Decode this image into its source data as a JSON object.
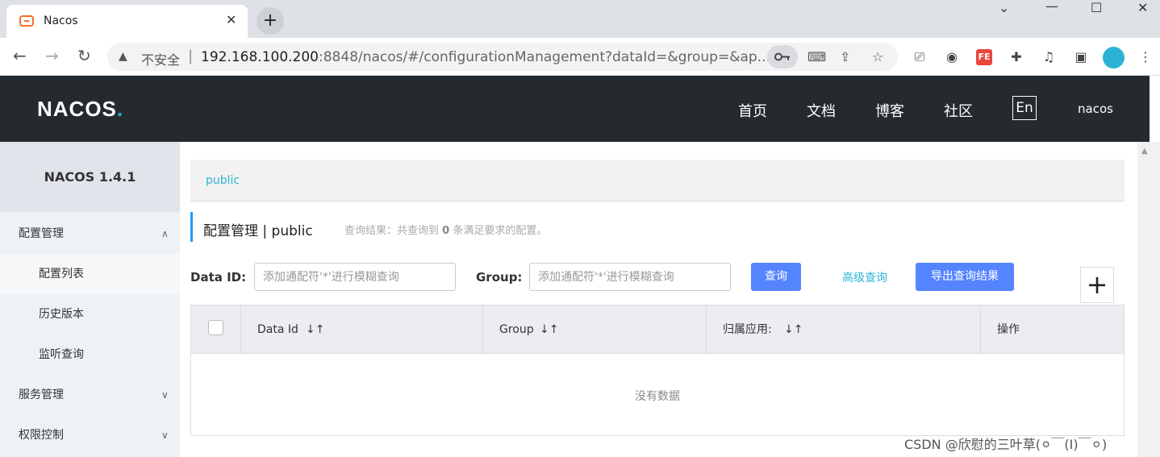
{
  "browser": {
    "tab_title": "Nacos",
    "tab_close": "✕",
    "new_tab": "+",
    "insecure_label": "不安全",
    "url_host": "192.168.100.200",
    "url_rest": ":8848/nacos/#/configurationManagement?dataId=&group=&ap...",
    "win_min": "⌄",
    "win_dash": "—",
    "win_max": "☐",
    "win_close": "✕",
    "fe_label": "FE"
  },
  "header": {
    "logo_main": "NACOS",
    "logo_dot": ".",
    "nav": [
      "首页",
      "文档",
      "博客",
      "社区"
    ],
    "lang": "En",
    "user": "nacos"
  },
  "sidebar": {
    "version": "NACOS 1.4.1",
    "groups": [
      {
        "label": "配置管理",
        "chev": "∧"
      },
      {
        "label": "服务管理",
        "chev": "∨"
      },
      {
        "label": "权限控制",
        "chev": "∨"
      }
    ],
    "sub_items": [
      "配置列表",
      "历史版本",
      "监听查询"
    ]
  },
  "main": {
    "breadcrumb": "public",
    "title": "配置管理 | public",
    "query_result_prefix": "查询结果：共查询到",
    "query_result_count": "0",
    "query_result_suffix": "条满足要求的配置。",
    "dataid_label": "Data ID:",
    "dataid_placeholder": "添加通配符'*'进行模糊查询",
    "group_label": "Group:",
    "group_placeholder": "添加通配符'*'进行模糊查询",
    "search_button": "查询",
    "advanced_link": "高级查询",
    "export_button": "导出查询结果",
    "add_button": "+",
    "columns": [
      "Data Id",
      "Group",
      "归属应用:",
      "操作"
    ],
    "sort_glyph": "↓↑",
    "empty_text": "没有数据"
  },
  "watermark": "CSDN @欣慰的三叶草(⚪￣(I)￣⚪)",
  "colors": {
    "header_bg": "#252a2f",
    "accent": "#2eb4d6",
    "primary_button": "#5584ff"
  }
}
